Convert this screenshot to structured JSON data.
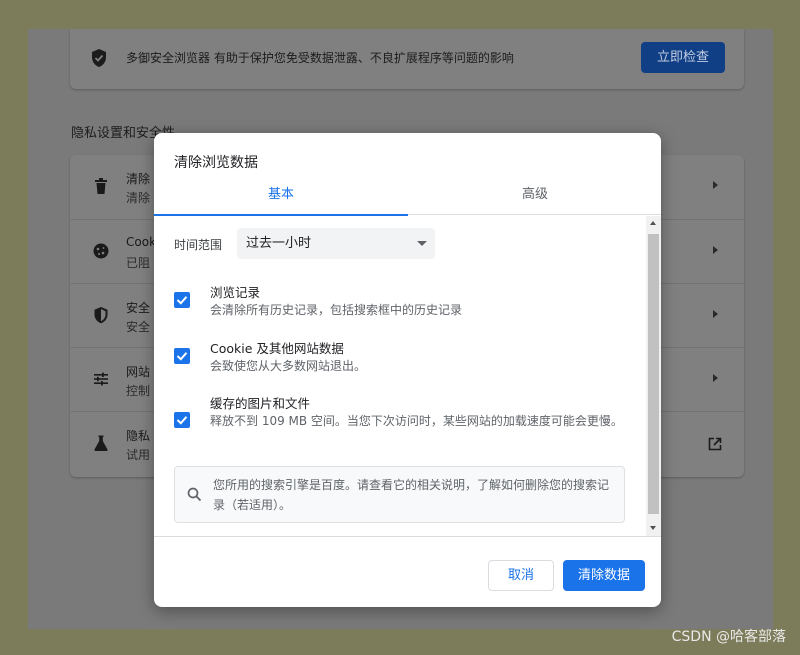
{
  "background_page": {
    "safety_check": {
      "icon": "shield-check-icon",
      "text": "多御安全浏览器 有助于保护您免受数据泄露、不良扩展程序等问题的影响",
      "button_label": "立即检查"
    },
    "privacy_section_title": "隐私设置和安全性",
    "rows": [
      {
        "icon": "trash-icon",
        "title": "清除",
        "subtitle": "清除"
      },
      {
        "icon": "cookie-icon",
        "title": "Cook",
        "subtitle": "已阻"
      },
      {
        "icon": "shield-icon",
        "title": "安全",
        "subtitle": "安全"
      },
      {
        "icon": "sliders-icon",
        "title": "网站",
        "subtitle": "控制"
      },
      {
        "icon": "flask-icon",
        "title": "隐私",
        "subtitle": "试用"
      }
    ]
  },
  "dialog": {
    "title": "清除浏览数据",
    "tabs": [
      {
        "label": "基本",
        "active": true
      },
      {
        "label": "高级",
        "active": false
      }
    ],
    "time_range": {
      "label": "时间范围",
      "selected": "过去一小时"
    },
    "options": [
      {
        "title": "浏览记录",
        "description": "会清除所有历史记录，包括搜索框中的历史记录",
        "checked": true
      },
      {
        "title": "Cookie 及其他网站数据",
        "description": "会致使您从大多数网站退出。",
        "checked": true
      },
      {
        "title": "缓存的图片和文件",
        "description": "释放不到 109 MB 空间。当您下次访问时，某些网站的加载速度可能会更慢。",
        "checked": true
      }
    ],
    "notice": {
      "icon": "search-icon",
      "text": "您所用的搜索引擎是百度。请查看它的相关说明，了解如何删除您的搜索记录（若适用）。"
    },
    "buttons": {
      "cancel": "取消",
      "clear": "清除数据"
    }
  },
  "watermark": "CSDN @哈客部落",
  "colors": {
    "accent": "#1a73e8",
    "overlay_page": "#7a7a7a",
    "outer_border": "#7c7c5a"
  }
}
